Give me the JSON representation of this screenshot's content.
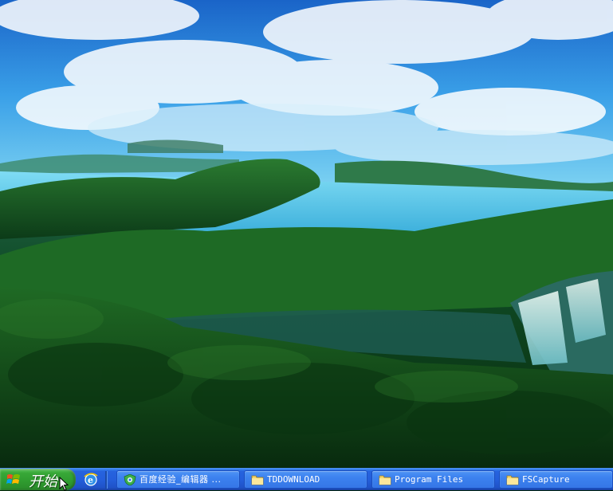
{
  "desktop": {
    "wallpaper": "forest-lake-waterfall",
    "colors": {
      "sky": "#3a9be6",
      "lake": "#5cc6ea",
      "forest": "#0f4a22"
    }
  },
  "taskbar": {
    "start_label": "开始",
    "quicklaunch_icon": "internet-explorer-icon",
    "tasks": [
      {
        "label": "百度经验_编辑器 ...",
        "icon": "browser-shield-icon"
      },
      {
        "label": "TDDOWNLOAD",
        "icon": "folder-icon"
      },
      {
        "label": "Program Files",
        "icon": "folder-icon"
      },
      {
        "label": "FSCapture",
        "icon": "folder-icon"
      }
    ],
    "colors": {
      "bar": "#245edb",
      "start": "#2f9b2f"
    }
  }
}
